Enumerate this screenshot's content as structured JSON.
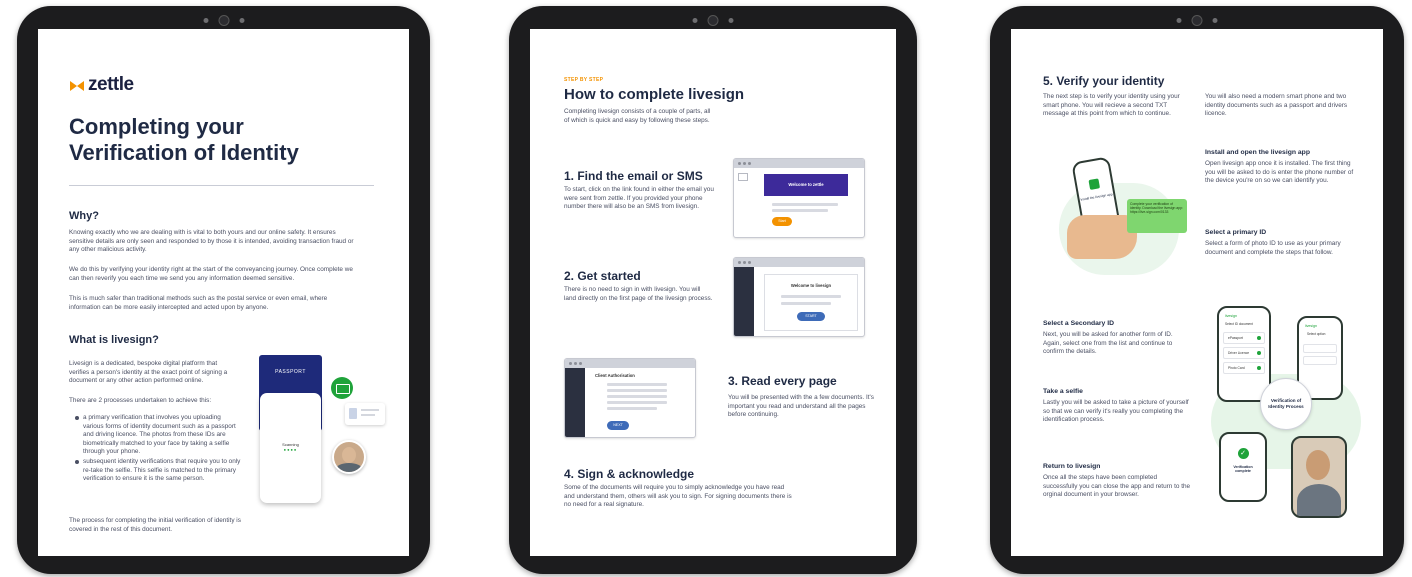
{
  "page1": {
    "logo": "zettle",
    "title_line1": "Completing your",
    "title_line2": "Verification of Identity",
    "why_heading": "Why?",
    "why_p1": "Knowing exactly who we are dealing with is vital to both yours and our online safety. It ensures sensitive details are only seen and responded to by those it is intended, avoiding transaction fraud or any other malicious activity.",
    "why_p2": "We do this by verifying your identity right at the start of the conveyancing journey. Once complete we can then reverify you each time we send you any information deemed sensitive.",
    "why_p3": "This is much safer than traditional methods such as the postal service or even email, where information can be more easily intercepted and acted upon by anyone.",
    "what_heading": "What is livesign?",
    "what_p1": "Livesign is a dedicated, bespoke digital platform that verifies a person's identity at the exact point of signing a document or any other action performed online.",
    "what_p2": "There are 2 processes undertaken to achieve this:",
    "bullet1": "a primary verification that involves you uploading various forms of identity document such as a passport and driving licence. The photos from these IDs are biometrically matched to your face by taking a selfie through your phone.",
    "bullet2": "subsequent identity verifications that require you to only re-take the selfie. This selfie is matched to the primary verification to ensure it is the same person.",
    "what_p3": "The process for completing the initial verification of identity is covered in the rest of this document.",
    "passport_label": "PASSPORT",
    "scanning_label": "Scanning"
  },
  "page2": {
    "kicker": "STEP BY STEP",
    "title": "How to complete livesign",
    "intro": "Completing livesign consists of a couple of parts, all of which is quick and easy by following these steps.",
    "step1_title": "1. Find the email or SMS",
    "step1_text": "To start, click on the link found in either the email you were sent from zettle. If you provided your phone number there will also be an SMS from livesign.",
    "step1_mock_title": "Welcome to zettle",
    "step1_mock_btn": "Start",
    "step2_title": "2. Get started",
    "step2_text": "There is no need to sign in with livesign. You will land directly on the first page of the livesign process.",
    "step2_mock_title": "Welcome to livesign",
    "step2_mock_btn": "START",
    "step3_title": "3. Read every page",
    "step3_text": "You will be presented with the a few documents. It's important you read and understand all the pages before continuing.",
    "step3_mock_title": "Client Authorisation",
    "step3_mock_btn": "NEXT",
    "step4_title": "4. Sign & acknowledge",
    "step4_text": "Some of the documents will require you to simply acknowledge you have read and understand them, others will ask you to sign. For signing documents there is no need for a real signature."
  },
  "page3": {
    "title": "5. Verify your identity",
    "intro_left": "The next step is to verify your identity using your smart phone. You will recieve a second TXT message at this point from which to continue.",
    "intro_right": "You will also need a modern smart phone and two identity documents such as a passport and drivers licence.",
    "install_heading": "Install and open the livesign app",
    "install_text": "Open livesign app once it is installed. The first thing you will be asked to do is enter the phone number of the device you're on so we can identify you.",
    "primary_heading": "Select a primary ID",
    "primary_text": "Select a form of photo ID to use as your primary document and complete the steps that follow.",
    "secondary_heading": "Select a Secondary ID",
    "secondary_text": "Next, you will be asked for another form of ID. Again, select one from the list and continue to confirm the details.",
    "selfie_heading": "Take a selfie",
    "selfie_text": "Lastly you will be asked to take a picture of yourself so that we can verify it's really you completing the identification process.",
    "return_heading": "Return to livesign",
    "return_text": "Once all the steps have been completed successfully you can close the app and return to the orginal document in your browser.",
    "sms_bubble": "Complete your verification of identity. Download the livesign app: https://live-sign.com/0133",
    "phone_label": "Install the livesign app",
    "app_name": "livesign",
    "app_list_title": "Select ID document",
    "app_opt1": "ePassport",
    "app_opt2": "Driver Licence",
    "app_opt3": "Photo Card",
    "app_select_title": "Select option",
    "circle_text": "Verification of Identity Process",
    "complete_label": "Verification complete"
  },
  "colors": {
    "navy": "#1f2a44",
    "orange": "#f39200",
    "purple": "#3d2a9a",
    "green": "#1fa33a",
    "screen_dark": "#2b3040",
    "btn_blue": "#3e6bb8"
  }
}
